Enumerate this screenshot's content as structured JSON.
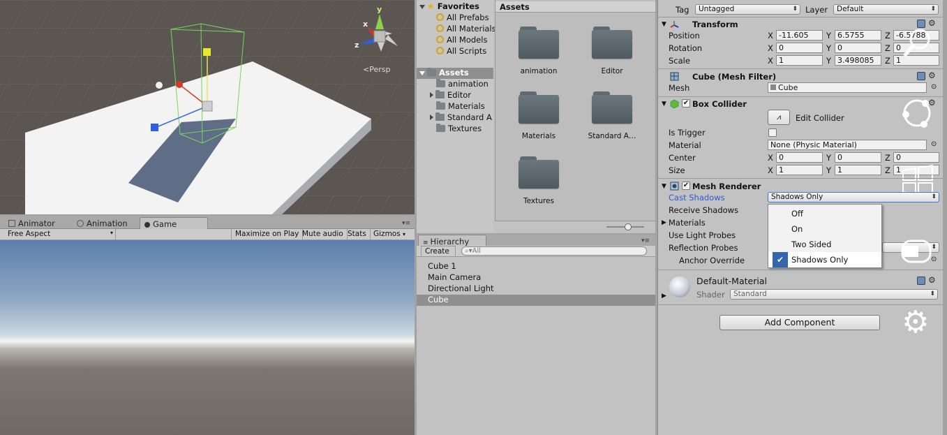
{
  "scene": {
    "persp_label": "Persp",
    "gizmo_axes": {
      "y": "y",
      "x": "x",
      "z": "z"
    }
  },
  "game": {
    "tabs": [
      {
        "label": "Animator"
      },
      {
        "label": "Animation"
      },
      {
        "label": "Game"
      }
    ],
    "toolbar": {
      "aspect": "Free Aspect",
      "maximize": "Maximize on Play",
      "mute": "Mute audio",
      "stats": "Stats",
      "gizmos": "Gizmos"
    }
  },
  "project": {
    "favorites": {
      "label": "Favorites",
      "items": [
        "All Prefabs",
        "All Materials",
        "All Models",
        "All Scripts"
      ]
    },
    "assets_tree": {
      "label": "Assets",
      "items": [
        "animation",
        "Editor",
        "Materials",
        "Standard A",
        "Textures"
      ]
    },
    "assets_header": "Assets",
    "folders": [
      "animation",
      "Editor",
      "Materials",
      "Standard A…",
      "Textures"
    ]
  },
  "hierarchy": {
    "tab": "Hierarchy",
    "create": "Create",
    "search_placeholder": "All",
    "items": [
      "Cube 1",
      "Main Camera",
      "Directional Light",
      "Cube"
    ]
  },
  "inspector": {
    "tag_label": "Tag",
    "tag_value": "Untagged",
    "layer_label": "Layer",
    "layer_value": "Default",
    "transform": {
      "title": "Transform",
      "position": {
        "label": "Position",
        "x": "-11.605",
        "y": "6.5755",
        "z": "-6.5788"
      },
      "rotation": {
        "label": "Rotation",
        "x": "0",
        "y": "0",
        "z": "0"
      },
      "scale": {
        "label": "Scale",
        "x": "1",
        "y": "3.498085",
        "z": "1"
      }
    },
    "mesh_filter": {
      "title": "Cube (Mesh Filter)",
      "mesh_label": "Mesh",
      "mesh_value": "Cube"
    },
    "box_collider": {
      "title": "Box Collider",
      "edit_label": "Edit Collider",
      "is_trigger": "Is Trigger",
      "material_label": "Material",
      "material_value": "None (Physic Material)",
      "center": {
        "label": "Center",
        "x": "0",
        "y": "0",
        "z": "0"
      },
      "size": {
        "label": "Size",
        "x": "1",
        "y": "1",
        "z": "1"
      }
    },
    "mesh_renderer": {
      "title": "Mesh Renderer",
      "cast_shadows": "Cast Shadows",
      "cast_value": "Shadows Only",
      "receive_shadows": "Receive Shadows",
      "materials": "Materials",
      "light_probes": "Use Light Probes",
      "reflection_probes": "Reflection Probes",
      "anchor_override": "Anchor Override"
    },
    "dropdown_options": [
      "Off",
      "On",
      "Two Sided",
      "Shadows Only"
    ],
    "material": {
      "name": "Default-Material",
      "shader_label": "Shader",
      "shader_value": "Standard"
    },
    "add_component": "Add Component",
    "axis": {
      "x": "X",
      "y": "Y",
      "z": "Z"
    }
  }
}
